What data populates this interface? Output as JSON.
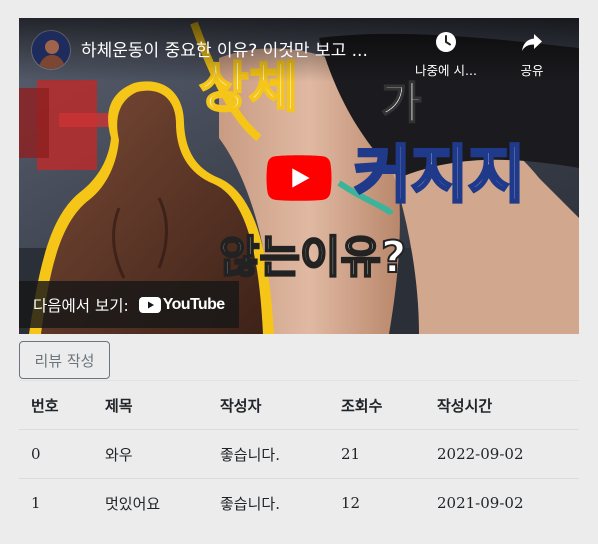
{
  "video": {
    "title": "하체운동이 중요한 이유? 이것만 보고 ...",
    "watch_later_label": "나중에 시...",
    "share_label": "공유",
    "watch_on_label": "다음에서 보기:",
    "youtube_wordmark": "YouTube",
    "thumbnail_text": {
      "line1_a": "상체",
      "line1_b": "가",
      "line2": "커지지",
      "line3": "않는이유?"
    }
  },
  "review_button_label": "리뷰 작성",
  "table": {
    "columns": [
      "번호",
      "제목",
      "작성자",
      "조회수",
      "작성시간"
    ],
    "rows": [
      [
        "0",
        "와우",
        "좋습니다.",
        "21",
        "2022-09-02"
      ],
      [
        "1",
        "멋있어요",
        "좋습니다.",
        "12",
        "2021-09-02"
      ]
    ]
  },
  "colors": {
    "page_background": "#ececec",
    "youtube_red": "#ff0000",
    "thumbnail_yellow": "#f5c518"
  }
}
